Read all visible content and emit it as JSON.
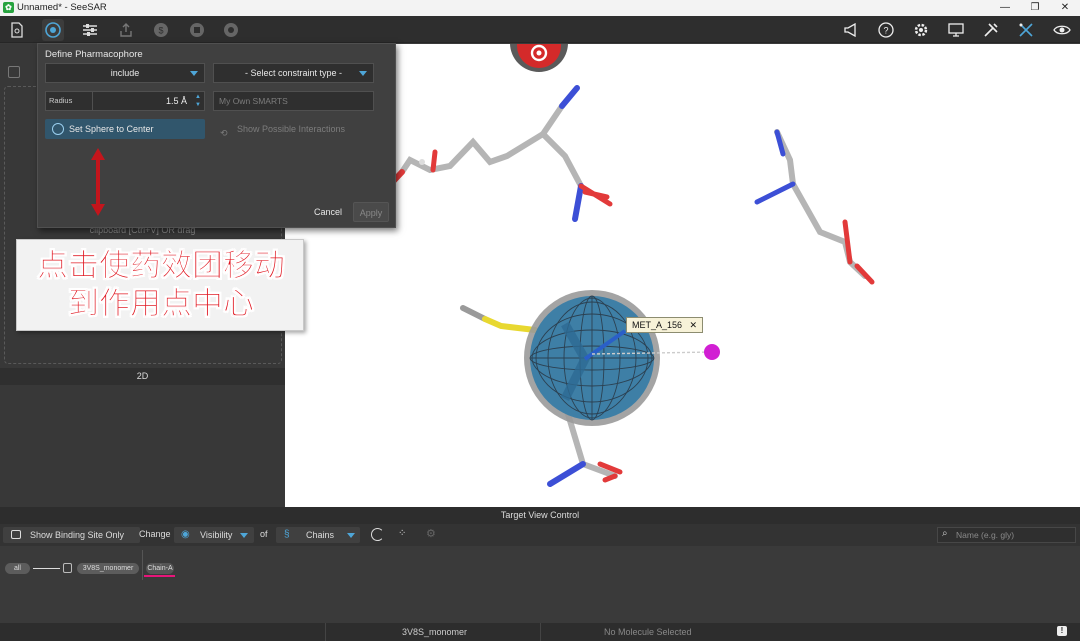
{
  "window": {
    "title": "Unnamed* - SeeSAR",
    "app_icon": "seesar-logo-icon"
  },
  "toolbar": {
    "icons": [
      "file-icon",
      "pharmacophore-icon",
      "sliders-icon",
      "export-icon",
      "dollar-icon",
      "filter-icon",
      "gear-flower-icon"
    ],
    "right_icons": [
      "megaphone-icon",
      "help-icon",
      "settings-icon",
      "monitor-icon",
      "tools-icon",
      "tools-alt-icon",
      "eye-icon"
    ]
  },
  "dialog": {
    "title": "Define Pharmacophore",
    "mode_select": "include",
    "constraint_select": "- Select constraint type -",
    "radius_label": "Radius",
    "radius_value": "1.5 Å",
    "smarts_placeholder": "My Own SMARTS",
    "set_sphere_label": "Set Sphere to Center",
    "show_interactions_label": "Show Possible Interactions",
    "cancel_label": "Cancel",
    "apply_label": "Apply"
  },
  "left_panel": {
    "clipboard_hint": "clipboard [Ctrl+V] OR drag",
    "label_2d": "2D"
  },
  "annotation": {
    "line1": "点击使药效团移动",
    "line2": "到作用点中心"
  },
  "viewport": {
    "residue_label": "MET_A_156",
    "accent_color": "#d42a2a"
  },
  "target_view_control": {
    "title": "Target View Control",
    "show_binding_label": "Show Binding Site Only",
    "change_label": "Change",
    "visibility_label": "Visibility",
    "of_label": "of",
    "chains_label": "Chains",
    "search_placeholder": "Name (e.g. gly)",
    "tree": {
      "all": "all",
      "monomer": "3V8S_monomer",
      "chain": "Chain-A"
    }
  },
  "status": {
    "molecule": "3V8S_monomer",
    "selection": "No Molecule Selected"
  }
}
